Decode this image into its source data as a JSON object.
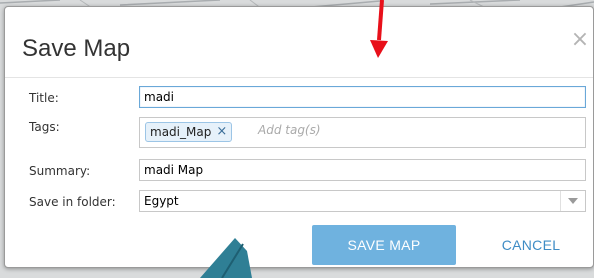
{
  "dialog": {
    "title": "Save Map",
    "close_icon": "close-icon"
  },
  "form": {
    "title_label": "Title:",
    "title_value": "madi",
    "tags_label": "Tags:",
    "tags": [
      "madi_Map"
    ],
    "tags_placeholder": "Add tag(s)",
    "summary_label": "Summary:",
    "summary_value": "madi Map",
    "folder_label": "Save in folder:",
    "folder_value": "Egypt"
  },
  "buttons": {
    "save_label": "SAVE MAP",
    "cancel_label": "CANCEL"
  },
  "colors": {
    "primary_button": "#6fb2df",
    "link_button": "#3e8cc5",
    "annotation_arrow_red": "#e8101a",
    "annotation_arrow_teal": "#2f7f95"
  },
  "icons": {
    "tag_remove": "close-icon",
    "dropdown": "chevron-down-icon"
  }
}
